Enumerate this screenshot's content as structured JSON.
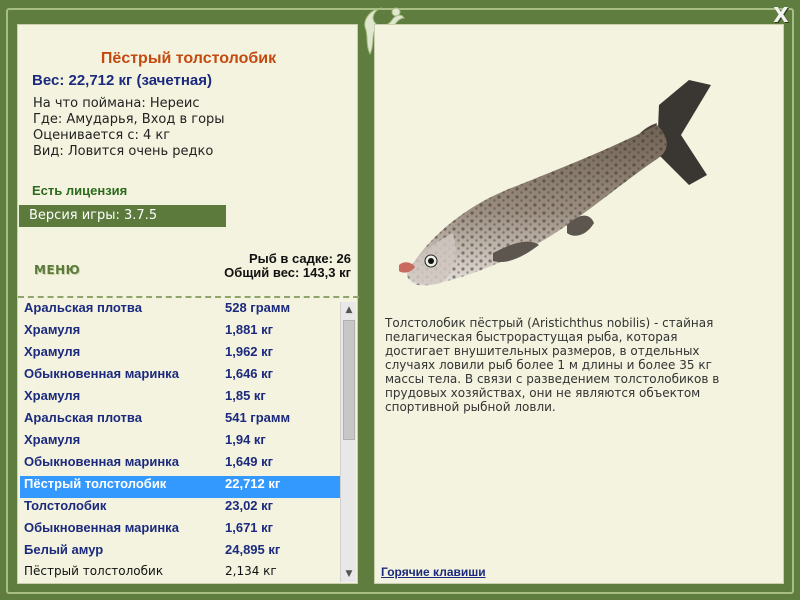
{
  "window": {
    "close_label": "X"
  },
  "fish": {
    "title": "Пёстрый толстолобик",
    "weight": "Вес: 22,712 кг (зачетная)",
    "details": [
      "На что поймана: Нереис",
      "Где: Амударья, Вход в горы",
      "Оценивается с: 4 кг",
      "Вид: Ловится очень редко"
    ],
    "license": "Есть лицензия",
    "description": "Толстолобик пёстрый (Aristichthus nobilis) - стайная пелагическая быстрорастущая рыба, которая достигает внушительных размеров, в отдельных случаях ловили рыб более 1 м длины и более 35 кг массы тела. В связи с разведением толстолобиков в прудовых хозяйствах, они не являются объектом спортивной рыбной ловли."
  },
  "version": "Версия игры: 3.7.5",
  "menu_label": "МЕНЮ",
  "stats": {
    "count": "Рыб в садке: 26",
    "total": "Общий вес: 143,3 кг"
  },
  "catch_list": [
    {
      "name": "Аральская плотва",
      "weight": "528 грамм"
    },
    {
      "name": "Храмуля",
      "weight": "1,881 кг"
    },
    {
      "name": "Храмуля",
      "weight": "1,962 кг"
    },
    {
      "name": "Обыкновенная маринка",
      "weight": "1,646 кг"
    },
    {
      "name": "Храмуля",
      "weight": "1,85 кг"
    },
    {
      "name": "Аральская плотва",
      "weight": "541 грамм"
    },
    {
      "name": "Храмуля",
      "weight": "1,94 кг"
    },
    {
      "name": "Обыкновенная маринка",
      "weight": "1,649 кг"
    },
    {
      "name": "Пёстрый толстолобик",
      "weight": "22,712 кг"
    },
    {
      "name": "Толстолобик",
      "weight": "23,02 кг"
    },
    {
      "name": "Обыкновенная маринка",
      "weight": "1,671 кг"
    },
    {
      "name": "Белый амур",
      "weight": "24,895 кг"
    },
    {
      "name": "Пёстрый толстолобик",
      "weight": "2,134 кг"
    }
  ],
  "selected_index": 8,
  "plain_index": 12,
  "hotkeys_label": "Горячие клавиши",
  "icons": {
    "close": "close-icon",
    "logo": "lizard-logo-icon",
    "scroll_up": "arrow-up-icon",
    "scroll_down": "arrow-down-icon"
  },
  "colors": {
    "frame": "#5f7d3f",
    "panel": "#f4f3df",
    "title": "#c44a10",
    "accent_blue": "#1b2a7e",
    "selection": "#3399ff"
  }
}
